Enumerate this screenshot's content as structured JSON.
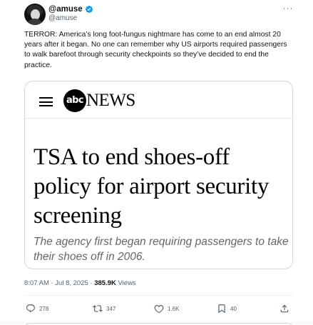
{
  "header": {
    "display_name": "@amuse",
    "handle": "@amuse",
    "more_label": "···"
  },
  "post": {
    "text": "TERROR: America’s long foot-fungus nightmare has come to an end almost 20 years after it began. No one can remember why US airports required passengers to walk barefoot through security checkpoints so they’ve decided to end the practice."
  },
  "card": {
    "logo_text": "abc",
    "brand_text": "NEWS",
    "headline": "TSA to end shoes-off policy for airport security screening",
    "subhead": "The agency first began requiring passengers to take their shoes off in 2006."
  },
  "meta": {
    "timestamp": "8:07 AM · Jul 8, 2025 · ",
    "views_count": "385.9K",
    "views_label": " Views"
  },
  "actions": {
    "replies": "278",
    "reposts": "347",
    "likes": "1.6K",
    "bookmarks": "40"
  },
  "icons": [
    "reply-icon",
    "repost-icon",
    "like-icon",
    "bookmark-icon",
    "share-icon",
    "verified-badge-icon",
    "hamburger-menu-icon"
  ],
  "colors": {
    "verified_blue": "#1d9bf0",
    "secondary_text": "#536471",
    "border": "#cfd9de"
  }
}
